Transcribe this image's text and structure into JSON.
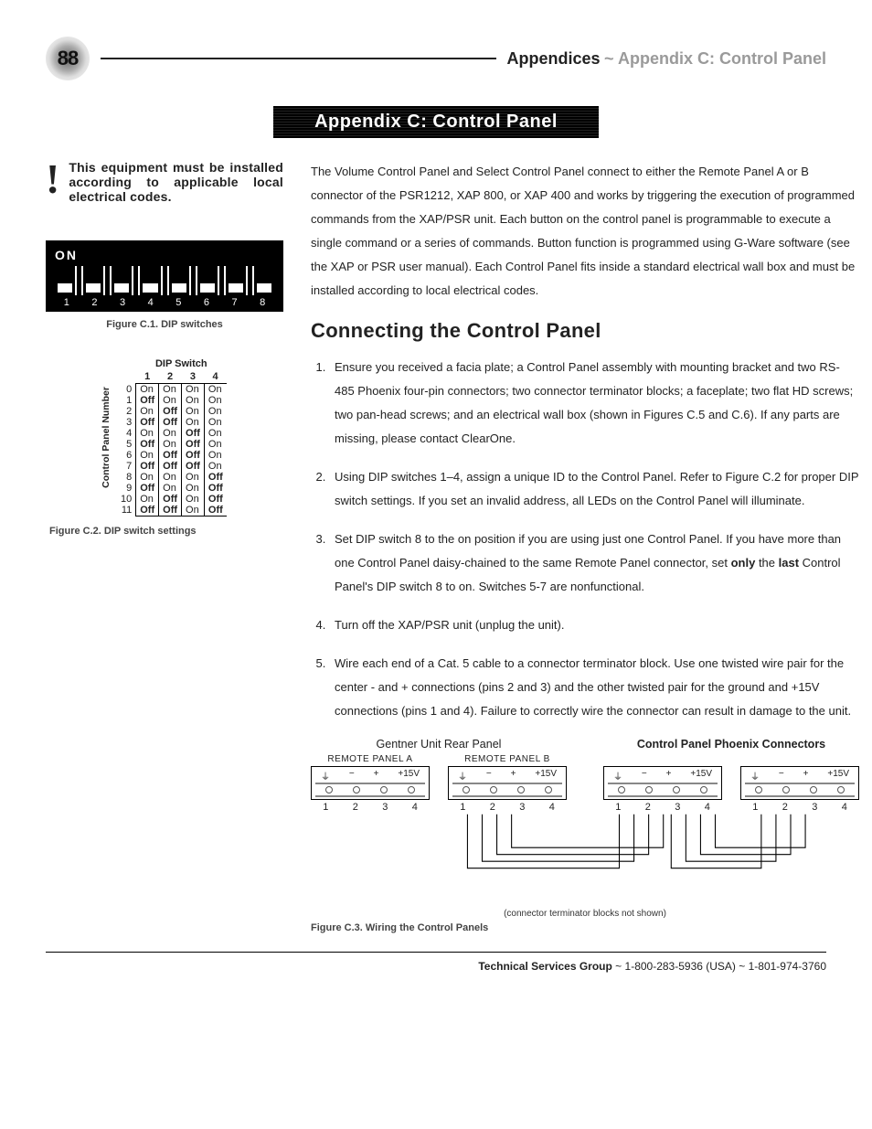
{
  "page_number": "88",
  "header": {
    "section": "Appendices",
    "tilde": "~",
    "title": "Appendix C: Control Panel"
  },
  "banner": "Appendix C: Control Panel",
  "warning": {
    "mark": "!",
    "text": "This equipment must be installed according to applicable local electrical codes."
  },
  "figures": {
    "dip_on_label": "ON",
    "dip_numbers": [
      "1",
      "2",
      "3",
      "4",
      "5",
      "6",
      "7",
      "8"
    ],
    "fig_c1": "Figure C.1. DIP switches",
    "fig_c2": "Figure C.2. DIP switch settings",
    "fig_c3": "Figure C.3. Wiring the Control Panels"
  },
  "dip_table": {
    "group_header": "DIP Switch",
    "col_headers": [
      "1",
      "2",
      "3",
      "4"
    ],
    "row_label": "Control Panel Number",
    "rows": [
      {
        "n": "0",
        "v": [
          "On",
          "On",
          "On",
          "On"
        ]
      },
      {
        "n": "1",
        "v": [
          "Off",
          "On",
          "On",
          "On"
        ]
      },
      {
        "n": "2",
        "v": [
          "On",
          "Off",
          "On",
          "On"
        ]
      },
      {
        "n": "3",
        "v": [
          "Off",
          "Off",
          "On",
          "On"
        ]
      },
      {
        "n": "4",
        "v": [
          "On",
          "On",
          "Off",
          "On"
        ]
      },
      {
        "n": "5",
        "v": [
          "Off",
          "On",
          "Off",
          "On"
        ]
      },
      {
        "n": "6",
        "v": [
          "On",
          "Off",
          "Off",
          "On"
        ]
      },
      {
        "n": "7",
        "v": [
          "Off",
          "Off",
          "Off",
          "On"
        ]
      },
      {
        "n": "8",
        "v": [
          "On",
          "On",
          "On",
          "Off"
        ]
      },
      {
        "n": "9",
        "v": [
          "Off",
          "On",
          "On",
          "Off"
        ]
      },
      {
        "n": "10",
        "v": [
          "On",
          "Off",
          "On",
          "Off"
        ]
      },
      {
        "n": "11",
        "v": [
          "Off",
          "Off",
          "On",
          "Off"
        ]
      }
    ]
  },
  "intro_para": "The Volume Control Panel and Select Control Panel connect to either the Remote Panel A or B connector of the PSR1212, XAP 800, or XAP 400 and works by triggering the execution of programmed commands from the XAP/PSR unit. Each button on the control panel is programmable to execute a single command or a series of commands. Button function is programmed using G-Ware software (see the XAP or PSR user manual). Each Control Panel fits inside a standard electrical wall box and must be installed according to local electrical codes.",
  "section_heading": "Connecting the Control Panel",
  "steps": {
    "s1": "Ensure you received a facia plate; a Control Panel assembly with mounting bracket and two RS-485 Phoenix four-pin connectors; two connector terminator blocks; a faceplate; two flat HD screws; two pan-head screws; and an electrical wall box (shown in Figures C.5 and C.6). If any parts are missing, please contact ClearOne.",
    "s2": "Using DIP switches 1–4, assign a unique ID to the Control Panel. Refer to Figure C.2 for proper DIP switch settings. If you set an invalid address, all LEDs on the Control Panel will illuminate.",
    "s3_a": "Set DIP switch 8 to the on position if you are using just one Control Panel. If you have more than one Control Panel daisy-chained to the same Remote Panel connector, set ",
    "s3_only": "only",
    "s3_b": " the ",
    "s3_last": "last",
    "s3_c": " Control Panel's DIP switch 8 to on. Switches 5-7 are nonfunctional.",
    "s4": "Turn off the XAP/PSR unit (unplug the unit).",
    "s5": "Wire each end of a Cat. 5 cable to a connector terminator block. Use one twisted wire pair for the center - and + connections (pins 2 and 3) and the other twisted pair for the ground and +15V connections (pins 1 and 4). Failure to correctly wire the connector can result in damage to the unit."
  },
  "diagram": {
    "gentner_title": "Gentner Unit Rear Panel",
    "cpp_title": "Control Panel Phoenix Connectors",
    "remote_a": "REMOTE PANEL A",
    "remote_b": "REMOTE PANEL B",
    "pin_labels": [
      "⏚",
      "−",
      "+",
      "+15V"
    ],
    "pin_nums": [
      "1",
      "2",
      "3",
      "4"
    ],
    "note": "(connector terminator blocks not shown)"
  },
  "footer": {
    "group": "Technical Services Group",
    "rest": " ~ 1-800-283-5936 (USA) ~ 1-801-974-3760"
  }
}
